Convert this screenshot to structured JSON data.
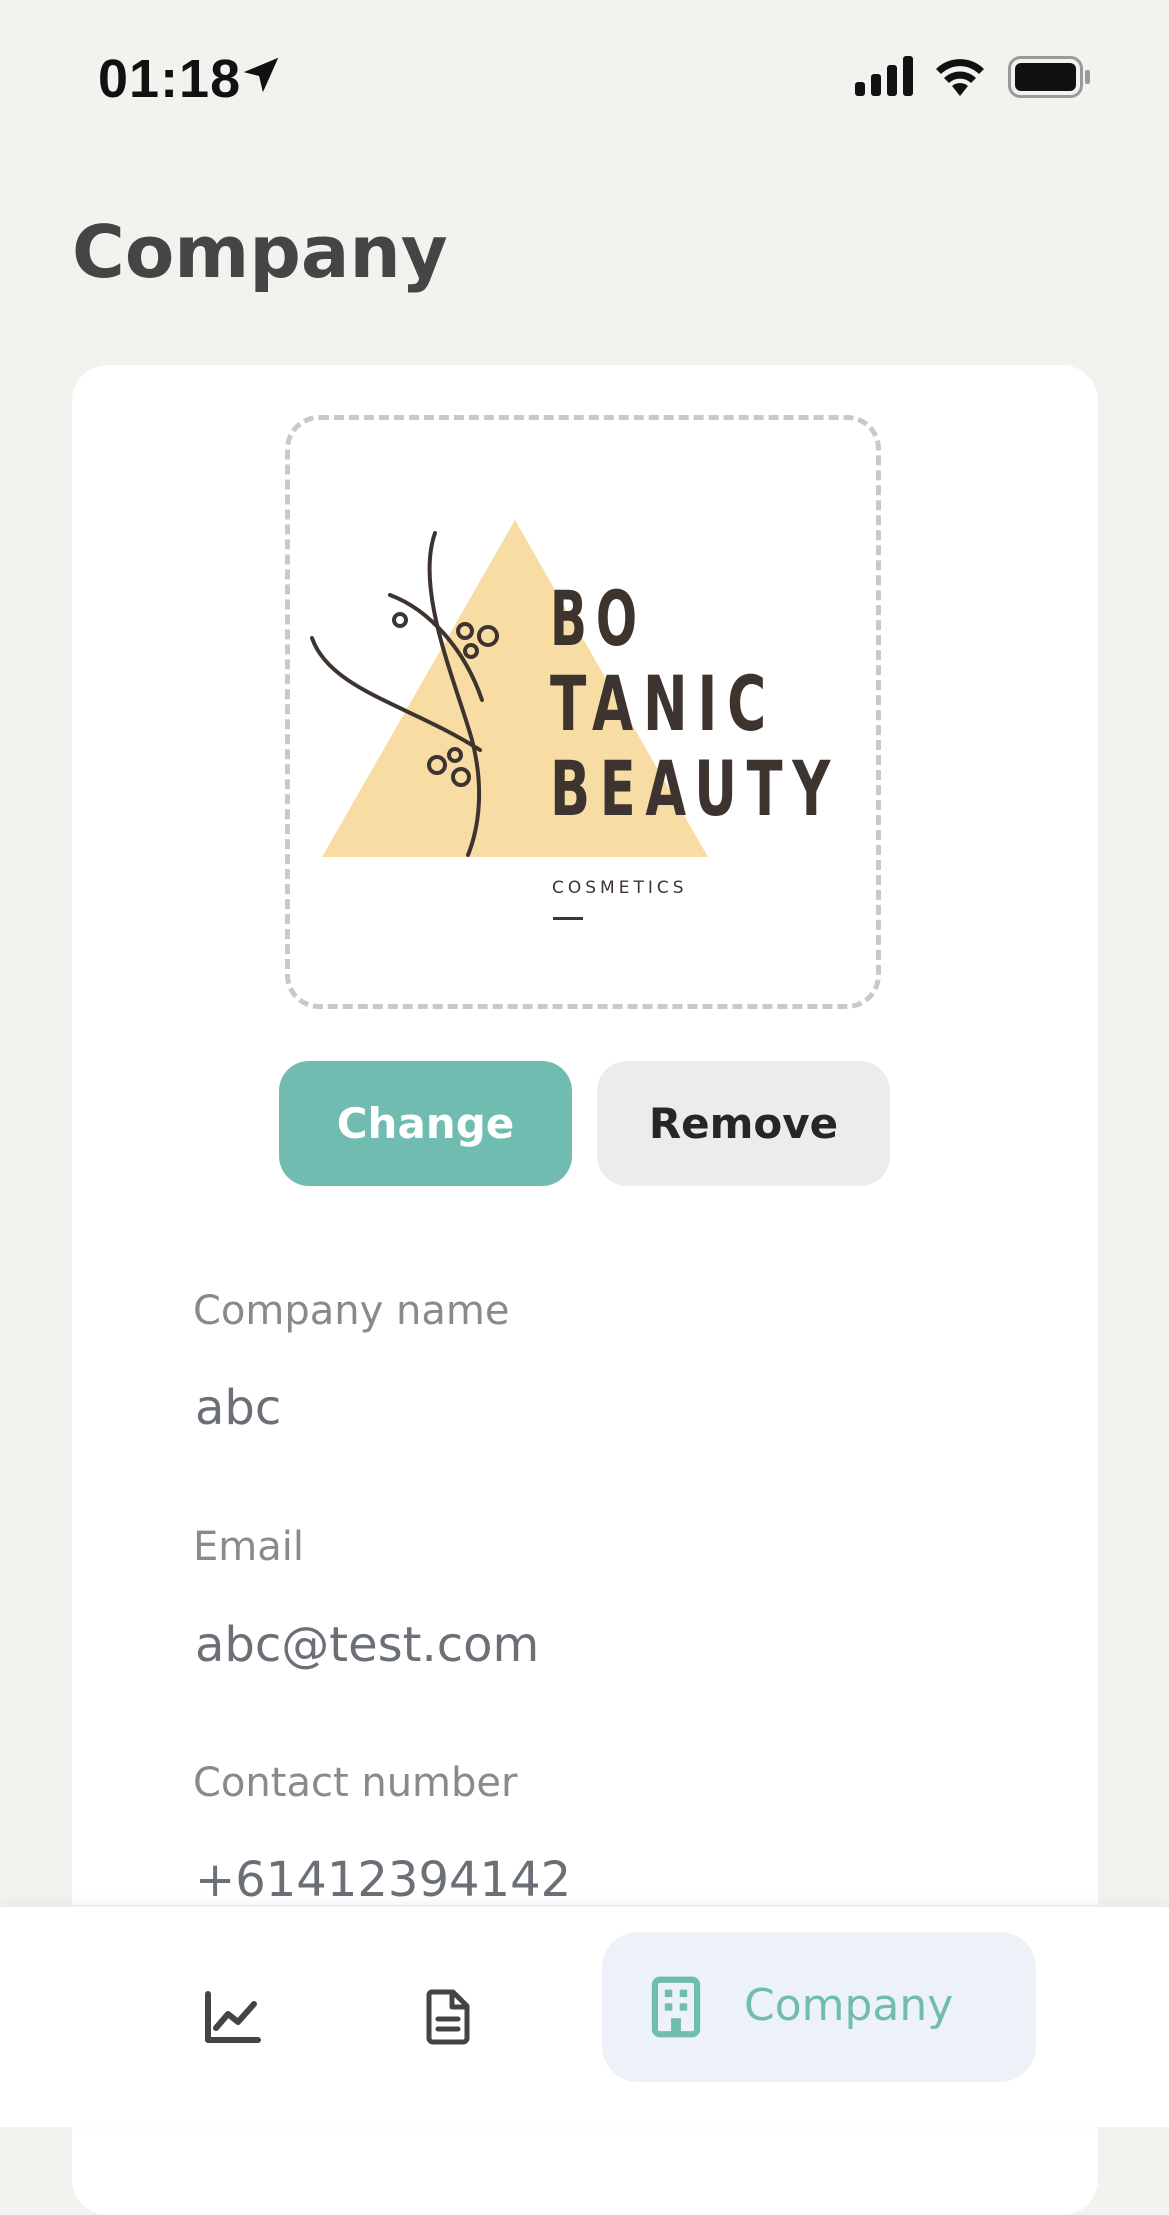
{
  "status_bar": {
    "time": "01:18",
    "icons": [
      "location-arrow-icon",
      "signal-bars-icon",
      "wifi-icon",
      "battery-icon"
    ]
  },
  "page": {
    "title": "Company"
  },
  "logo": {
    "line1": "BO",
    "line2": "TANIC",
    "line3": "BEAUTY",
    "tagline": "COSMETICS",
    "colors": {
      "triangle": "#f7dca3",
      "ink": "#3e342f"
    }
  },
  "actions": {
    "change_label": "Change",
    "remove_label": "Remove"
  },
  "fields": {
    "company_name": {
      "label": "Company name",
      "value": "abc"
    },
    "email": {
      "label": "Email",
      "value": "abc@test.com"
    },
    "contact_number": {
      "label": "Contact number",
      "value": "+61412394142"
    }
  },
  "bottom_nav": {
    "items": [
      {
        "icon": "chart-line-icon",
        "label": ""
      },
      {
        "icon": "document-icon",
        "label": ""
      },
      {
        "icon": "building-icon",
        "label": "Company"
      }
    ]
  },
  "colors": {
    "accent": "#70bcb0",
    "background": "#f3f2ef",
    "card": "#ffffff",
    "title": "#454545",
    "nav_active_bg": "#edf2f9"
  }
}
